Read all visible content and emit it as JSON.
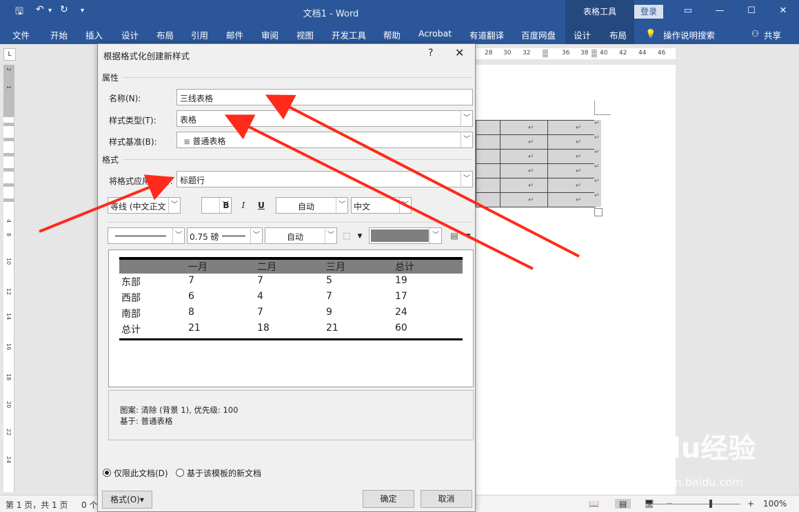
{
  "window": {
    "doc_title": "文档1 - Word",
    "context_group": "表格工具",
    "login": "登录"
  },
  "ribbon": {
    "tabs": [
      "文件",
      "开始",
      "插入",
      "设计",
      "布局",
      "引用",
      "邮件",
      "审阅",
      "视图",
      "开发工具",
      "帮助",
      "Acrobat",
      "有道翻译",
      "百度网盘",
      "设计",
      "布局"
    ],
    "tell_me": "操作说明搜索",
    "share": "共享"
  },
  "ruler": {
    "h_labels": [
      "28",
      "30",
      "32",
      "36",
      "38",
      "40",
      "42",
      "44",
      "46"
    ],
    "v_labels": [
      "2",
      "1",
      "1",
      "2",
      "4",
      "6",
      "8",
      "10",
      "12",
      "14",
      "16",
      "18",
      "20",
      "22",
      "24"
    ]
  },
  "doc_table": {
    "cell_mark": "↵",
    "rows": 6
  },
  "dialog": {
    "title": "根据格式化创建新样式",
    "help": "?",
    "close": "✕",
    "section_properties": "属性",
    "name_label": "名称(N):",
    "name_value": "三线表格",
    "type_label": "样式类型(T):",
    "type_value": "表格",
    "base_label": "样式基准(B):",
    "base_value": "普通表格",
    "section_format": "格式",
    "apply_label": "将格式应用于(P):",
    "apply_value": "标题行",
    "font_value": "等线 (中文正文",
    "bold": "B",
    "italic": "I",
    "underline": "U",
    "color_value": "自动",
    "lang_value": "中文",
    "line_weight": "0.75 磅",
    "border_color": "自动",
    "preview": {
      "header": [
        "",
        "一月",
        "二月",
        "三月",
        "总计"
      ],
      "rows": [
        [
          "东部",
          "7",
          "7",
          "5",
          "19"
        ],
        [
          "西部",
          "6",
          "4",
          "7",
          "17"
        ],
        [
          "南部",
          "8",
          "7",
          "9",
          "24"
        ],
        [
          "总计",
          "21",
          "18",
          "21",
          "60"
        ]
      ]
    },
    "desc_line1": "图案: 清除 (背景 1), 优先级: 100",
    "desc_line2": "基于: 普通表格",
    "radio_this_doc": "仅限此文档(D)",
    "radio_template": "基于该模板的新文档",
    "format_btn": "格式(O)▾",
    "ok_btn": "确定",
    "cancel_btn": "取消"
  },
  "status": {
    "page": "第 1 页，共 1 页",
    "words": "0 个",
    "zoom": "100%"
  },
  "watermark": {
    "logo": "Baidu经验",
    "url": "jingyan.baidu.com"
  },
  "colors": {
    "accent": "#2b579a",
    "arrow": "#ff2a1a"
  }
}
